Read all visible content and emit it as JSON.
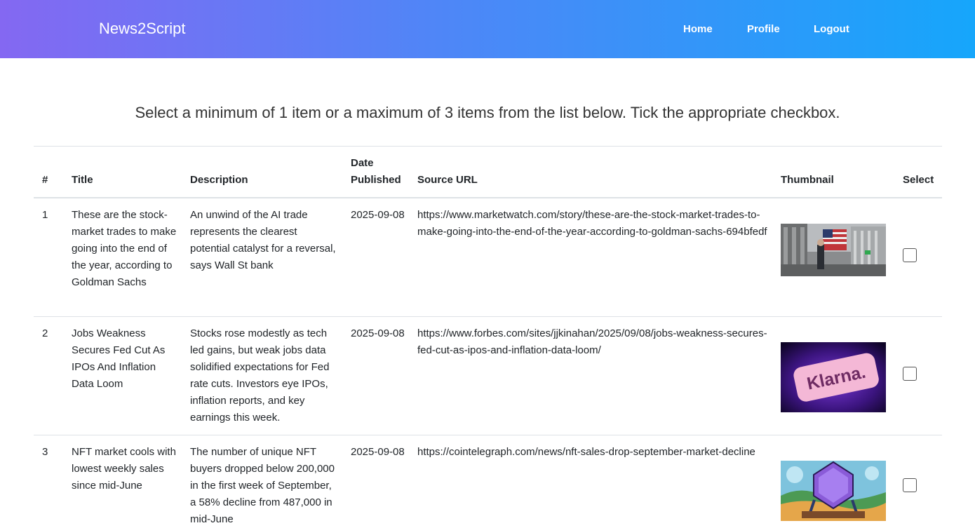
{
  "nav": {
    "brand": "News2Script",
    "links": [
      "Home",
      "Profile",
      "Logout"
    ]
  },
  "instructions": "Select a minimum of 1 item or a maximum of 3 items from the list below. Tick the appropriate checkbox.",
  "table": {
    "headers": {
      "num": "#",
      "title": "Title",
      "description": "Description",
      "date_line1": "Date",
      "date_line2": "Published",
      "url": "Source URL",
      "thumbnail": "Thumbnail",
      "select": "Select"
    },
    "rows": [
      {
        "num": "1",
        "title": "These are the stock-market trades to make going into the end of the year, according to Goldman Sachs",
        "description": "An unwind of the AI trade represents the clearest potential catalyst for a reversal, says Wall St bank",
        "date": "2025-09-08",
        "url": "https://www.marketwatch.com/story/these-are-the-stock-market-trades-to-make-going-into-the-end-of-the-year-according-to-goldman-sachs-694bfedf",
        "selected": false
      },
      {
        "num": "2",
        "title": "Jobs Weakness Secures Fed Cut As IPOs And Inflation Data Loom",
        "description": "Stocks rose modestly as tech led gains, but weak jobs data solidified expectations for Fed rate cuts. Investors eye IPOs, inflation reports, and key earnings this week.",
        "date": "2025-09-08",
        "url": "https://www.forbes.com/sites/jjkinahan/2025/09/08/jobs-weakness-secures-fed-cut-as-ipos-and-inflation-data-loom/",
        "thumb_text": "Klarna.",
        "selected": false
      },
      {
        "num": "3",
        "title": "NFT market cools with lowest weekly sales since mid-June",
        "description": "The number of unique NFT buyers dropped below 200,000 in the first week of September, a 58% decline from 487,000 in mid-June",
        "date": "2025-09-08",
        "url": "https://cointelegraph.com/news/nft-sales-drop-september-market-decline",
        "selected": false
      }
    ]
  }
}
